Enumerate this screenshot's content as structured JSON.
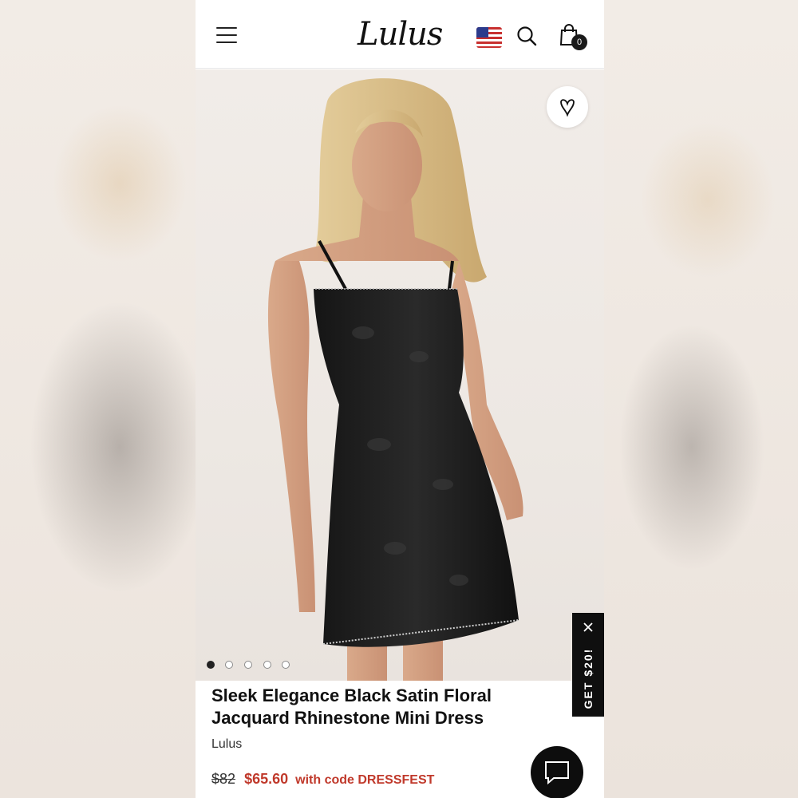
{
  "header": {
    "logo_text": "Lulus",
    "cart_count": "0"
  },
  "gallery": {
    "image_count": 5,
    "active_index": 0
  },
  "promo": {
    "label": "GET $20!"
  },
  "product": {
    "title": "Sleek Elegance Black Satin Floral Jacquard Rhinestone Mini Dress",
    "brand": "Lulus",
    "original_price": "$82",
    "sale_price": "$65.60",
    "code_text": "with code DRESSFEST"
  },
  "colors": {
    "sale": "#c0392b",
    "dark": "#0f0f0f"
  },
  "icons": [
    "menu-icon",
    "us-flag-icon",
    "search-icon",
    "shopping-bag-icon",
    "heart-icon",
    "close-icon",
    "chat-icon"
  ]
}
